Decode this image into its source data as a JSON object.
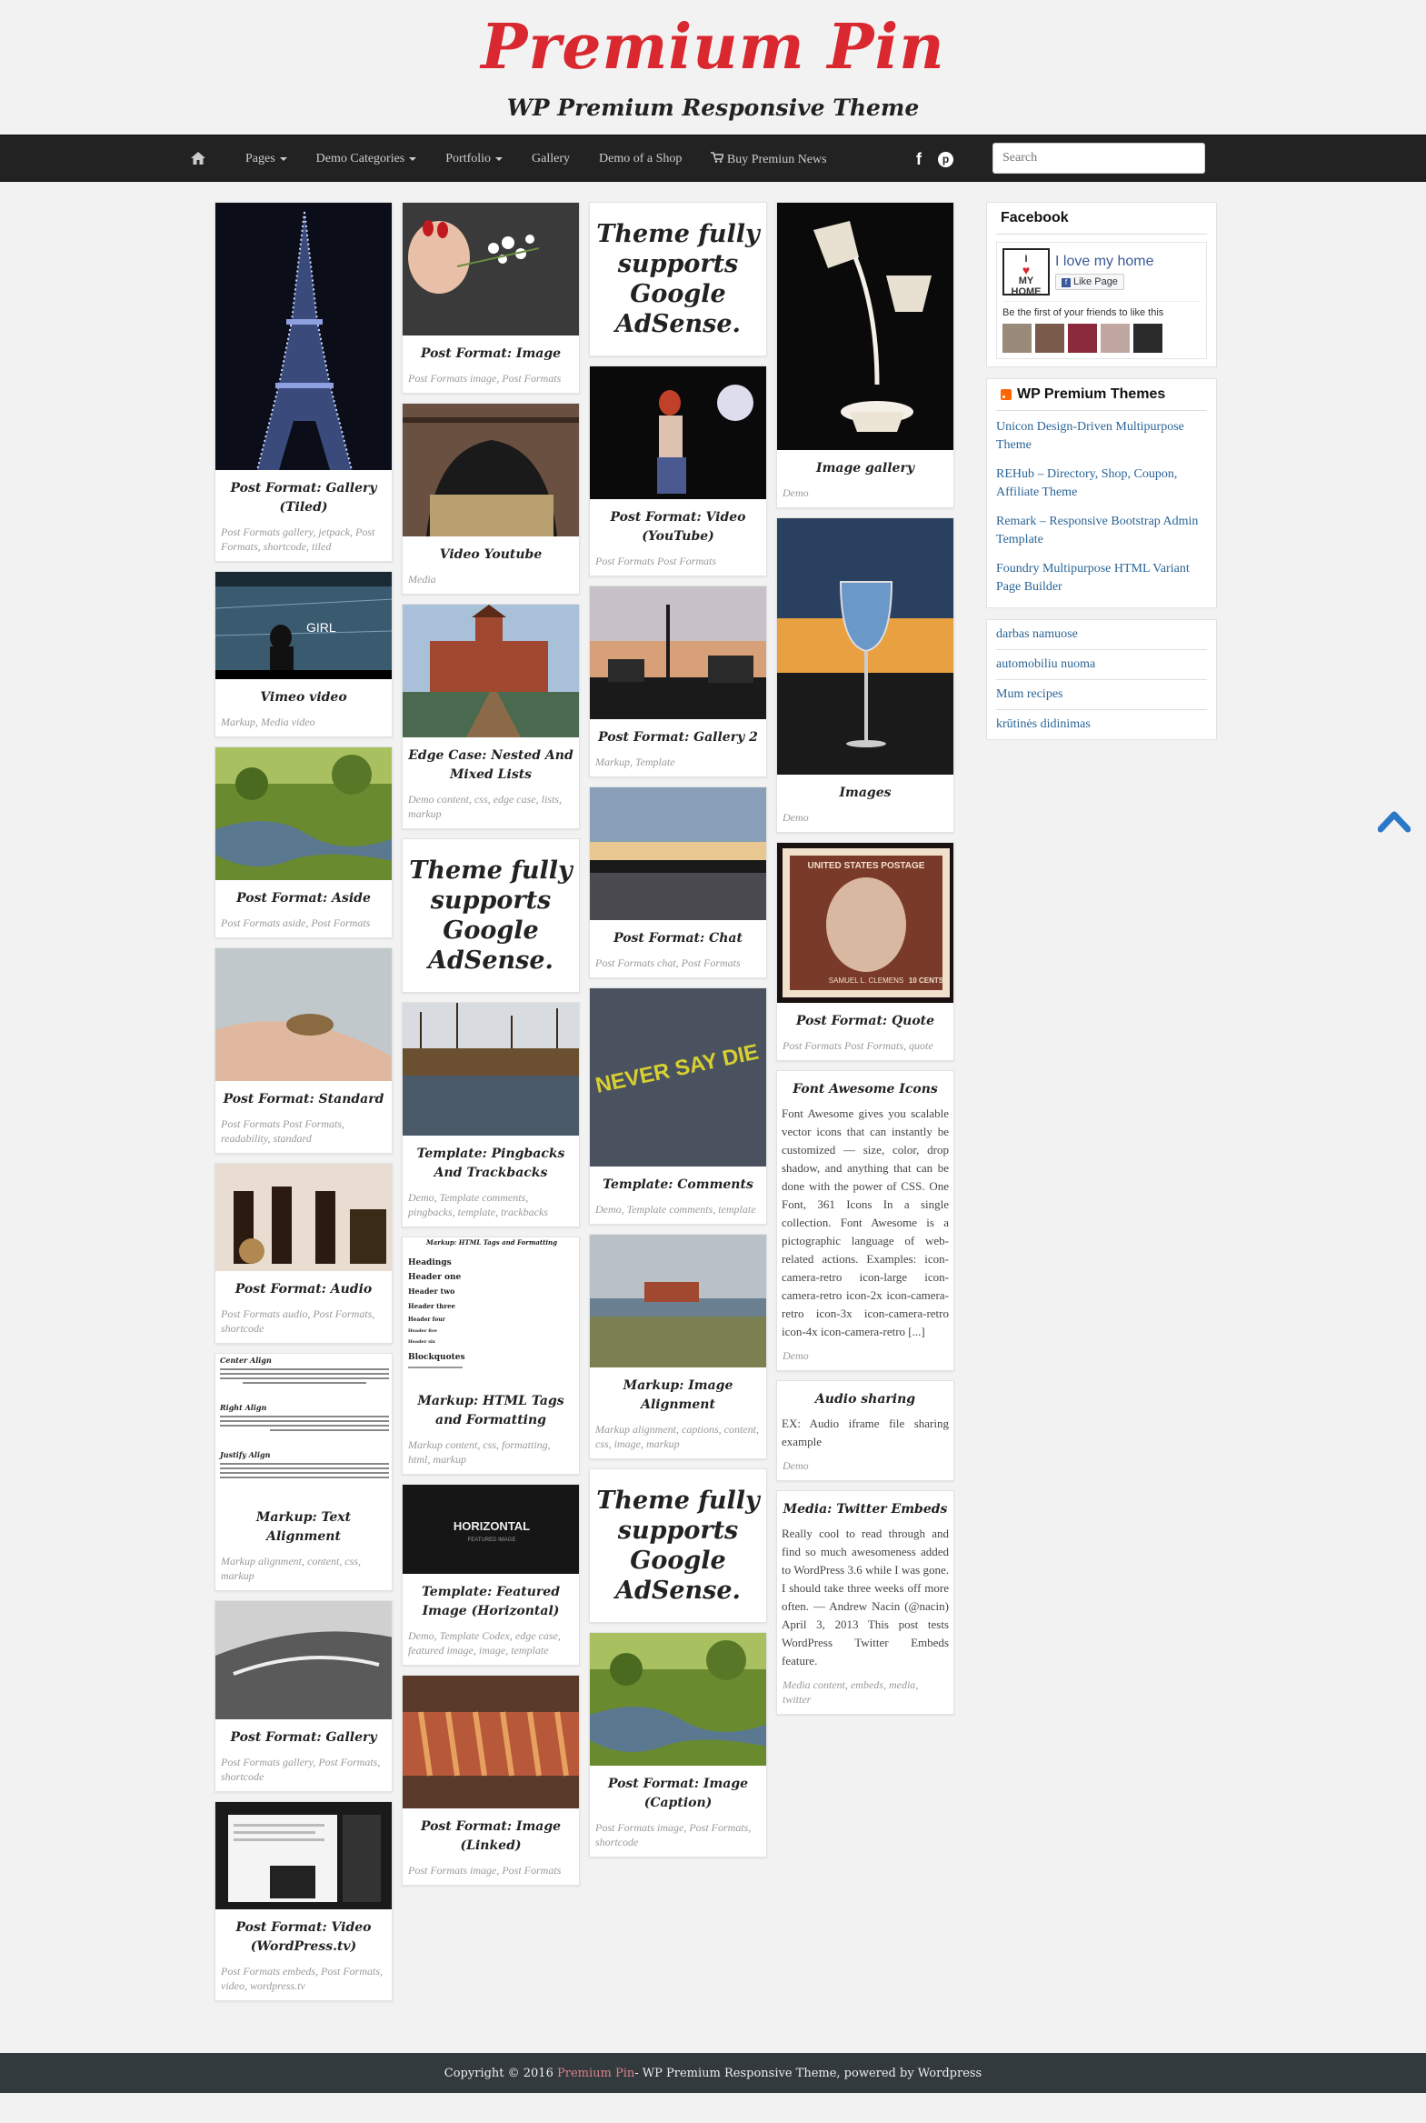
{
  "header": {
    "site_title": "Premium Pin",
    "tagline": "WP Premium Responsive Theme"
  },
  "nav": {
    "items": [
      "Pages",
      "Demo Categories",
      "Portfolio",
      "Gallery",
      "Demo of a Shop",
      "Buy Premiun News"
    ],
    "search_placeholder": "Search"
  },
  "ad_text": "Theme fully supports Google AdSense.",
  "col1": [
    {
      "title": "Post Format: Gallery (Tiled)",
      "meta": "Post Formats gallery, jetpack, Post Formats, shortcode, tiled"
    },
    {
      "title": "Vimeo video",
      "meta": "Markup, Media video",
      "img_text": "GIRL"
    },
    {
      "title": "Post Format: Aside",
      "meta": "Post Formats aside, Post Formats"
    },
    {
      "title": "Post Format: Standard",
      "meta": "Post Formats Post Formats, readability, standard"
    },
    {
      "title": "Post Format: Audio",
      "meta": "Post Formats audio, Post Formats, shortcode"
    },
    {
      "title": "Markup: Text Alignment",
      "meta": "Markup alignment, content, css, markup",
      "img_labels": [
        "Center Align",
        "Right Align",
        "Justify Align"
      ]
    },
    {
      "title": "Post Format: Gallery",
      "meta": "Post Formats gallery, Post Formats, shortcode"
    },
    {
      "title": "Post Format: Video (WordPress.tv)",
      "meta": "Post Formats embeds, Post Formats, video, wordpress.tv"
    }
  ],
  "col2": [
    {
      "title": "Post Format: Image",
      "meta": "Post Formats image, Post Formats"
    },
    {
      "title": "Video Youtube",
      "meta": "Media"
    },
    {
      "title": "Edge Case: Nested And Mixed Lists",
      "meta": "Demo content, css, edge case, lists, markup"
    },
    {
      "title": "Template: Pingbacks And Trackbacks",
      "meta": "Demo, Template comments, pingbacks, template, trackbacks"
    },
    {
      "title": "Markup: HTML Tags and Formatting",
      "meta": "Markup content, css, formatting, html, markup",
      "img_heading": "Markup: HTML Tags and Formatting",
      "img_lines": [
        "Headings",
        "Header one",
        "Header two",
        "Header three",
        "Header four",
        "Header five",
        "Header six",
        "Blockquotes"
      ]
    },
    {
      "title": "Template: Featured Image (Horizontal)",
      "meta": "Demo, Template Codex, edge case, featured image, image, template",
      "img_text": "HORIZONTAL",
      "img_sub": "FEATURED IMAGE"
    },
    {
      "title": "Post Format: Image (Linked)",
      "meta": "Post Formats image, Post Formats"
    }
  ],
  "col3": [
    {
      "title": "Post Format: Video (YouTube)",
      "meta": "Post Formats Post Formats"
    },
    {
      "title": "Post Format: Gallery 2",
      "meta": "Markup, Template"
    },
    {
      "title": "Post Format: Chat",
      "meta": "Post Formats chat, Post Formats"
    },
    {
      "title": "Template: Comments",
      "meta": "Demo, Template comments, template",
      "img_text": "NEVER SAY DIE"
    },
    {
      "title": "Markup: Image Alignment",
      "meta": "Markup alignment, captions, content, css, image, markup"
    },
    {
      "title": "Post Format: Image (Caption)",
      "meta": "Post Formats image, Post Formats, shortcode"
    }
  ],
  "col4": [
    {
      "title": "Image gallery",
      "meta": "Demo"
    },
    {
      "title": "Images",
      "meta": "Demo"
    },
    {
      "title": "Post Format: Quote",
      "meta": "Post Formats Post Formats, quote",
      "img_text": "UNITED STATES POSTAGE",
      "img_name": "SAMUEL L. CLEMENS",
      "img_value": "10 CENTS"
    },
    {
      "title": "Font Awesome Icons",
      "meta": "Demo",
      "excerpt": "Font Awesome gives you scalable vector icons that can instantly be customized — size, color, drop shadow, and anything that can be done with the power of CSS. One Font, 361 Icons In a single collection. Font Awesome is a pictographic language of web-related actions. Examples: icon-camera-retro icon-large icon-camera-retro icon-2x icon-camera-retro icon-3x icon-camera-retro icon-4x icon-camera-retro [...]"
    },
    {
      "title": "Audio sharing",
      "meta": "Demo",
      "excerpt": "EX: Audio iframe file sharing example"
    },
    {
      "title": "Media: Twitter Embeds",
      "meta": "Media content, embeds, media, twitter",
      "excerpt": "Really cool to read through and find so much awesomeness added to WordPress 3.6 while I was gone. I should take three weeks off more often. — Andrew Nacin (@nacin) April 3, 2013 This post tests WordPress Twitter Embeds feature."
    }
  ],
  "sidebar": {
    "facebook": {
      "title": "Facebook",
      "page_name": "I love my home",
      "like_label": "Like Page",
      "logo_top": "I",
      "logo_mid": "MY",
      "logo_bot": "HOME",
      "friends_text": "Be the first of your friends to like this"
    },
    "rss": {
      "title": "WP Premium Themes",
      "links": [
        "Unicon Design-Driven Multipurpose Theme",
        "REHub – Directory, Shop, Coupon, Affiliate Theme",
        "Remark – Responsive Bootstrap Admin Template",
        "Foundry Multipurpose HTML Variant Page Builder"
      ]
    },
    "links": [
      "darbas namuose",
      "automobiliu nuoma",
      "Mum recipes",
      "krūtinės didinimas"
    ]
  },
  "footer": {
    "prefix": "Copyright © 2016 ",
    "brand": "Premium Pin",
    "suffix": " - WP Premium Responsive Theme, powered by Wordpress"
  }
}
